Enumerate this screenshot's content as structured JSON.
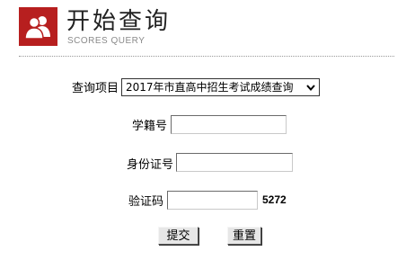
{
  "header": {
    "title": "开始查询",
    "subtitle": "SCORES QUERY",
    "logo_icon": "users-icon",
    "brand_color": "#b71f1f"
  },
  "form": {
    "project_label": "查询项目",
    "project_selected": "2017年市直高中招生考试成绩查询",
    "student_id_label": "学籍号",
    "student_id_value": "",
    "id_card_label": "身份证号",
    "id_card_value": "",
    "captcha_label": "验证码",
    "captcha_value": "",
    "captcha_code": "5272"
  },
  "buttons": {
    "submit_label": "提交",
    "reset_label": "重置"
  }
}
